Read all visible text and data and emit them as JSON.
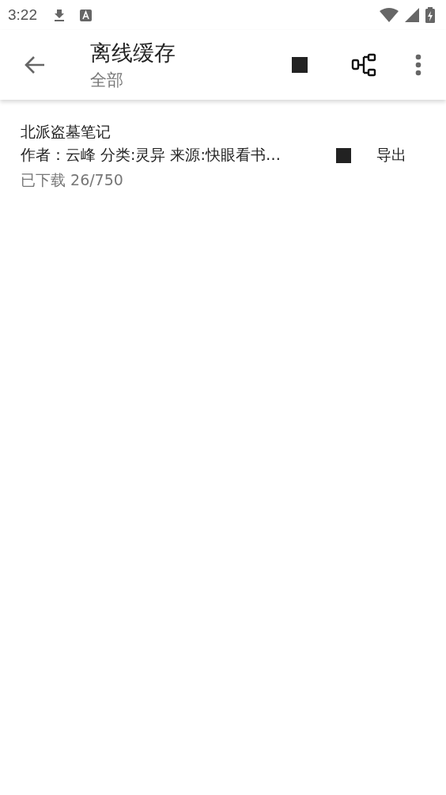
{
  "status_bar": {
    "time": "3:22"
  },
  "toolbar": {
    "title": "离线缓存",
    "subtitle": "全部"
  },
  "books": [
    {
      "title": "北派盗墓笔记",
      "meta": "作者：云峰 分类:灵异 来源:快眼看书…",
      "progress": "已下载 26/750",
      "export": "导出"
    }
  ]
}
